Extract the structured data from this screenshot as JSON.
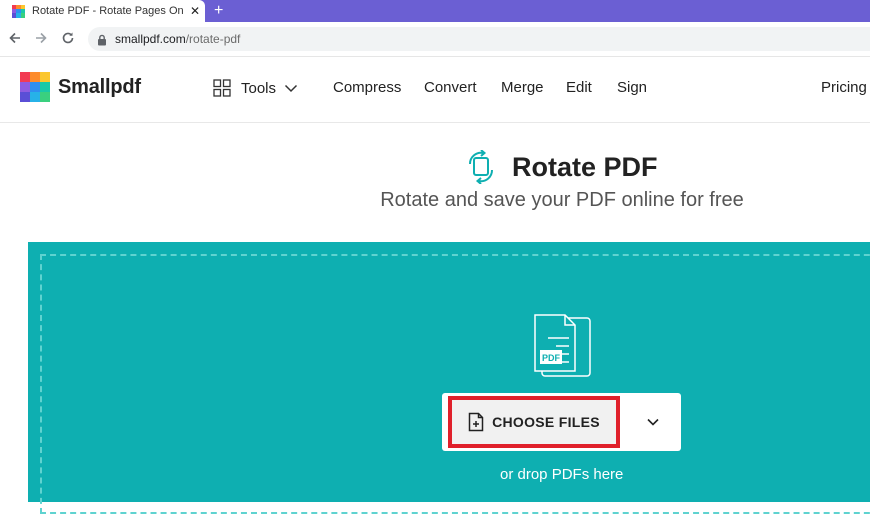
{
  "browser": {
    "tab_title": "Rotate PDF - Rotate Pages Online",
    "tab_close": "✕",
    "new_tab": "+",
    "url_domain": "smallpdf.com",
    "url_path": "/rotate-pdf"
  },
  "header": {
    "logo_text": "Smallpdf",
    "tools_label": "Tools",
    "nav": [
      "Compress",
      "Convert",
      "Merge",
      "Edit",
      "Sign",
      "Pricing"
    ]
  },
  "hero": {
    "title": "Rotate PDF",
    "subtitle": "Rotate and save your PDF online for free"
  },
  "dropzone": {
    "choose_label": "CHOOSE FILES",
    "drop_hint": "or drop PDFs here",
    "pdf_badge": "PDF"
  },
  "colors": {
    "tab_strip": "#6b5fd3",
    "dropzone_bg": "#0eafb1",
    "highlight": "#e0202b",
    "logo": [
      "#f23b52",
      "#fd8b2b",
      "#fbc62e",
      "#8e5ce0",
      "#2f8ff0",
      "#19c9a8",
      "#5a4fd6",
      "#27b2e8",
      "#3ad07f"
    ]
  }
}
